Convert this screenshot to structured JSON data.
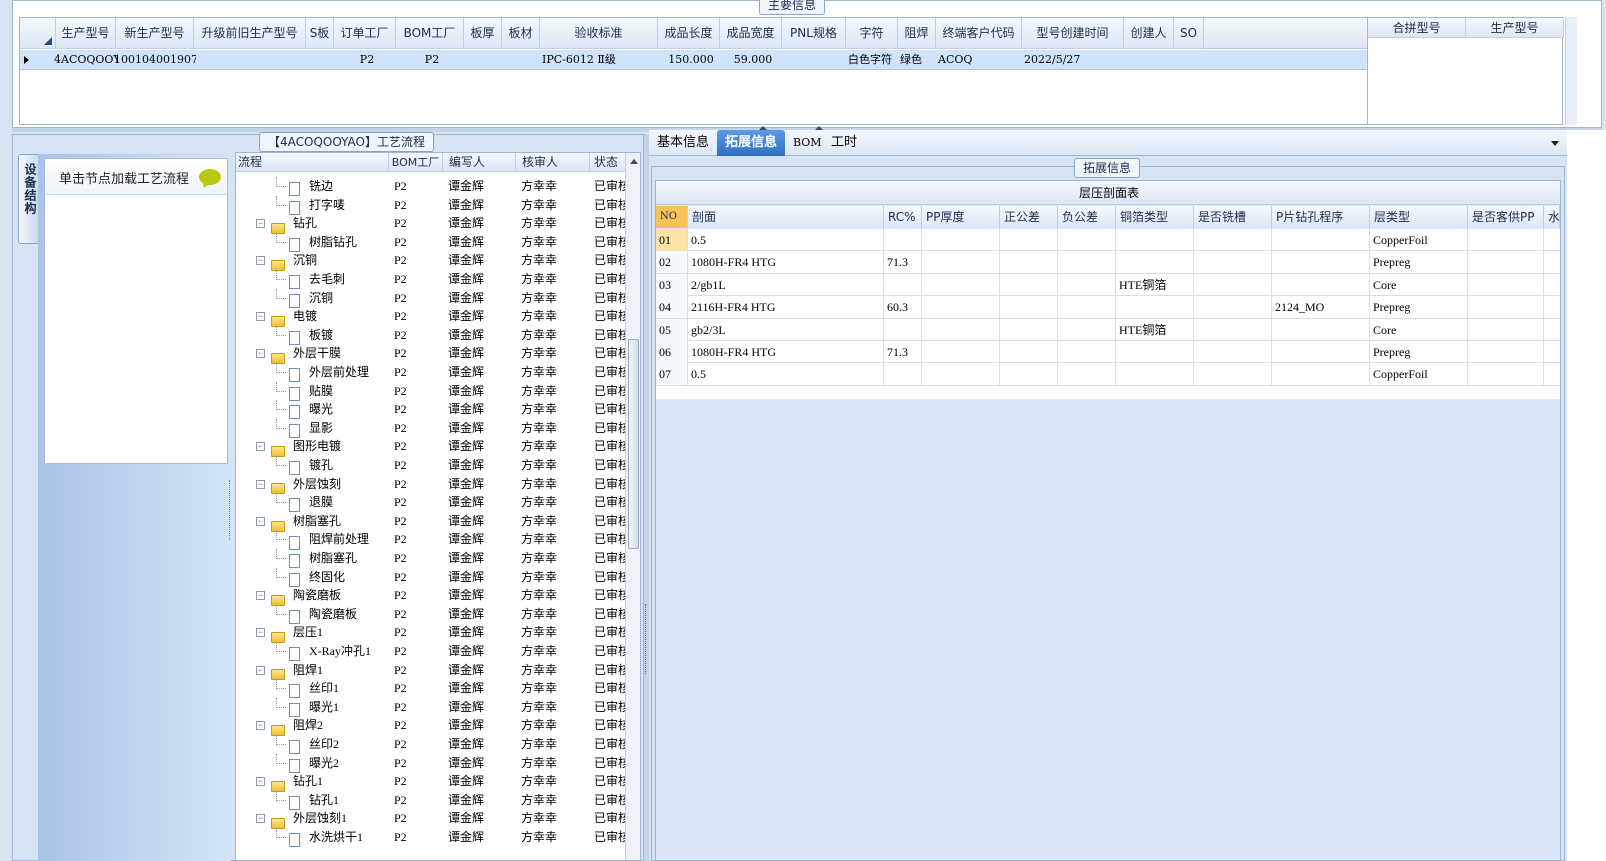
{
  "main_group": {
    "title": "主要信息"
  },
  "main_table": {
    "columns": [
      "生产型号",
      "新生产型号",
      "升级前旧生产型号",
      "S板",
      "订单工厂",
      "BOM工厂",
      "板厚",
      "板材",
      "验收标准",
      "成品长度",
      "成品宽度",
      "PNL规格",
      "字符",
      "阻焊",
      "终端客户代码",
      "型号创建时间",
      "创建人",
      "SO"
    ],
    "rows": [
      [
        "4ACOQOOYAO",
        "10010400190777",
        "",
        "",
        "P2",
        "P2",
        "",
        "",
        "IPC-6012 Ⅱ级",
        "150.000",
        "59.000",
        "",
        "白色字符",
        "绿色",
        "ACOQ",
        "2022/5/27",
        "",
        ""
      ]
    ]
  },
  "merge_table": {
    "columns": [
      "合拼型号",
      "生产型号"
    ]
  },
  "process_group": {
    "title": "【4ACOQOOYAO】工艺流程"
  },
  "side_tab": {
    "label": "设备结构"
  },
  "hint_box": {
    "text": "单击节点加载工艺流程"
  },
  "tree": {
    "columns": [
      "流程",
      "BOM工厂",
      "编写人",
      "核审人",
      "状态"
    ],
    "rows": [
      {
        "level": 2,
        "name": "铣边",
        "factory": "P2",
        "writer": "谭金辉",
        "reviewer": "方幸幸",
        "status": "已审核"
      },
      {
        "level": 2,
        "name": "打字唛",
        "factory": "P2",
        "writer": "谭金辉",
        "reviewer": "方幸幸",
        "status": "已审核"
      },
      {
        "level": 1,
        "name": "钻孔",
        "factory": "P2",
        "writer": "谭金辉",
        "reviewer": "方幸幸",
        "status": "已审核"
      },
      {
        "level": 2,
        "name": "树脂钻孔",
        "factory": "P2",
        "writer": "谭金辉",
        "reviewer": "方幸幸",
        "status": "已审核"
      },
      {
        "level": 1,
        "name": "沉铜",
        "factory": "P2",
        "writer": "谭金辉",
        "reviewer": "方幸幸",
        "status": "已审核"
      },
      {
        "level": 2,
        "name": "去毛刺",
        "factory": "P2",
        "writer": "谭金辉",
        "reviewer": "方幸幸",
        "status": "已审核"
      },
      {
        "level": 2,
        "name": "沉铜",
        "factory": "P2",
        "writer": "谭金辉",
        "reviewer": "方幸幸",
        "status": "已审核"
      },
      {
        "level": 1,
        "name": "电镀",
        "factory": "P2",
        "writer": "谭金辉",
        "reviewer": "方幸幸",
        "status": "已审核"
      },
      {
        "level": 2,
        "name": "板镀",
        "factory": "P2",
        "writer": "谭金辉",
        "reviewer": "方幸幸",
        "status": "已审核"
      },
      {
        "level": 1,
        "name": "外层干膜",
        "factory": "P2",
        "writer": "谭金辉",
        "reviewer": "方幸幸",
        "status": "已审核"
      },
      {
        "level": 2,
        "name": "外层前处理",
        "factory": "P2",
        "writer": "谭金辉",
        "reviewer": "方幸幸",
        "status": "已审核"
      },
      {
        "level": 2,
        "name": "贴膜",
        "factory": "P2",
        "writer": "谭金辉",
        "reviewer": "方幸幸",
        "status": "已审核"
      },
      {
        "level": 2,
        "name": "曝光",
        "factory": "P2",
        "writer": "谭金辉",
        "reviewer": "方幸幸",
        "status": "已审核"
      },
      {
        "level": 2,
        "name": "显影",
        "factory": "P2",
        "writer": "谭金辉",
        "reviewer": "方幸幸",
        "status": "已审核"
      },
      {
        "level": 1,
        "name": "图形电镀",
        "factory": "P2",
        "writer": "谭金辉",
        "reviewer": "方幸幸",
        "status": "已审核"
      },
      {
        "level": 2,
        "name": "镀孔",
        "factory": "P2",
        "writer": "谭金辉",
        "reviewer": "方幸幸",
        "status": "已审核"
      },
      {
        "level": 1,
        "name": "外层蚀刻",
        "factory": "P2",
        "writer": "谭金辉",
        "reviewer": "方幸幸",
        "status": "已审核"
      },
      {
        "level": 2,
        "name": "退膜",
        "factory": "P2",
        "writer": "谭金辉",
        "reviewer": "方幸幸",
        "status": "已审核"
      },
      {
        "level": 1,
        "name": "树脂塞孔",
        "factory": "P2",
        "writer": "谭金辉",
        "reviewer": "方幸幸",
        "status": "已审核"
      },
      {
        "level": 2,
        "name": "阻焊前处理",
        "factory": "P2",
        "writer": "谭金辉",
        "reviewer": "方幸幸",
        "status": "已审核"
      },
      {
        "level": 2,
        "name": "树脂塞孔",
        "factory": "P2",
        "writer": "谭金辉",
        "reviewer": "方幸幸",
        "status": "已审核"
      },
      {
        "level": 2,
        "name": "终固化",
        "factory": "P2",
        "writer": "谭金辉",
        "reviewer": "方幸幸",
        "status": "已审核"
      },
      {
        "level": 1,
        "name": "陶瓷磨板",
        "factory": "P2",
        "writer": "谭金辉",
        "reviewer": "方幸幸",
        "status": "已审核"
      },
      {
        "level": 2,
        "name": "陶瓷磨板",
        "factory": "P2",
        "writer": "谭金辉",
        "reviewer": "方幸幸",
        "status": "已审核"
      },
      {
        "level": 1,
        "name": "层压1",
        "factory": "P2",
        "writer": "谭金辉",
        "reviewer": "方幸幸",
        "status": "已审核"
      },
      {
        "level": 2,
        "name": "X-Ray冲孔1",
        "factory": "P2",
        "writer": "谭金辉",
        "reviewer": "方幸幸",
        "status": "已审核"
      },
      {
        "level": 1,
        "name": "阻焊1",
        "factory": "P2",
        "writer": "谭金辉",
        "reviewer": "方幸幸",
        "status": "已审核"
      },
      {
        "level": 2,
        "name": "丝印1",
        "factory": "P2",
        "writer": "谭金辉",
        "reviewer": "方幸幸",
        "status": "已审核"
      },
      {
        "level": 2,
        "name": "曝光1",
        "factory": "P2",
        "writer": "谭金辉",
        "reviewer": "方幸幸",
        "status": "已审核"
      },
      {
        "level": 1,
        "name": "阻焊2",
        "factory": "P2",
        "writer": "谭金辉",
        "reviewer": "方幸幸",
        "status": "已审核"
      },
      {
        "level": 2,
        "name": "丝印2",
        "factory": "P2",
        "writer": "谭金辉",
        "reviewer": "方幸幸",
        "status": "已审核"
      },
      {
        "level": 2,
        "name": "曝光2",
        "factory": "P2",
        "writer": "谭金辉",
        "reviewer": "方幸幸",
        "status": "已审核"
      },
      {
        "level": 1,
        "name": "钻孔1",
        "factory": "P2",
        "writer": "谭金辉",
        "reviewer": "方幸幸",
        "status": "已审核"
      },
      {
        "level": 2,
        "name": "钻孔1",
        "factory": "P2",
        "writer": "谭金辉",
        "reviewer": "方幸幸",
        "status": "已审核"
      },
      {
        "level": 1,
        "name": "外层蚀刻1",
        "factory": "P2",
        "writer": "谭金辉",
        "reviewer": "方幸幸",
        "status": "已审核"
      },
      {
        "level": 2,
        "name": "水洗烘干1",
        "factory": "P2",
        "writer": "谭金辉",
        "reviewer": "方幸幸",
        "status": "已审核"
      }
    ]
  },
  "tabs": [
    {
      "label": "基本信息",
      "active": false
    },
    {
      "label": "拓展信息",
      "active": true
    },
    {
      "label": "BOM",
      "active": false
    },
    {
      "label": "工时",
      "active": false
    }
  ],
  "ext_group": {
    "title": "拓展信息"
  },
  "lamination": {
    "title": "层压剖面表",
    "columns": [
      "NO",
      "剖面",
      "RC%",
      "PP厚度",
      "正公差",
      "负公差",
      "铜箔类型",
      "是否铣槽",
      "P片钻孔程序",
      "层类型",
      "是否客供PP",
      "水"
    ],
    "rows": [
      [
        "01",
        "0.5",
        "",
        "",
        "",
        "",
        "",
        "",
        "",
        "CopperFoil",
        ""
      ],
      [
        "02",
        "1080H-FR4 HTG",
        "71.3",
        "",
        "",
        "",
        "",
        "",
        "",
        "Prepreg",
        ""
      ],
      [
        "03",
        "2/gb1L",
        "",
        "",
        "",
        "",
        "HTE铜箔",
        "",
        "",
        "Core",
        ""
      ],
      [
        "04",
        "2116H-FR4 HTG",
        "60.3",
        "",
        "",
        "",
        "",
        "",
        "2124_MO",
        "Prepreg",
        ""
      ],
      [
        "05",
        "gb2/3L",
        "",
        "",
        "",
        "",
        "HTE铜箔",
        "",
        "",
        "Core",
        ""
      ],
      [
        "06",
        "1080H-FR4 HTG",
        "71.3",
        "",
        "",
        "",
        "",
        "",
        "",
        "Prepreg",
        ""
      ],
      [
        "07",
        "0.5",
        "",
        "",
        "",
        "",
        "",
        "",
        "",
        "CopperFoil",
        ""
      ]
    ]
  },
  "colors": {
    "accent": "#3a78c8",
    "selected_row": "#cfe3fb",
    "panel_bg": "#d6e3f3",
    "grid_bg": "#ffffff"
  }
}
